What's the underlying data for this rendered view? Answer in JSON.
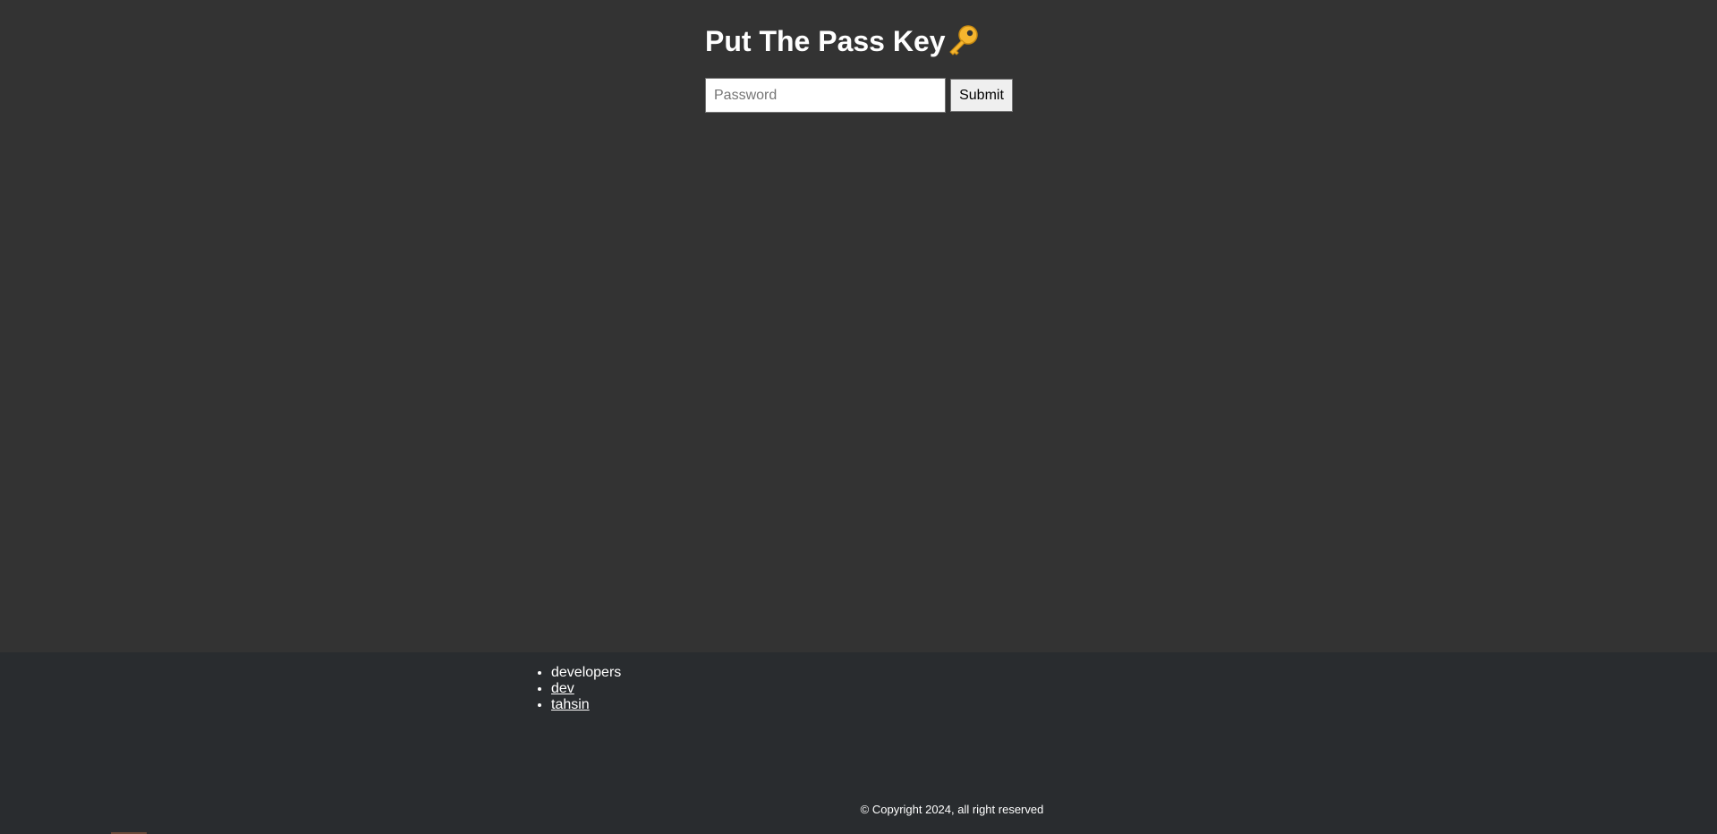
{
  "login": {
    "title": "Put The Pass Key",
    "title_icon": "key-icon",
    "password_placeholder": "Password",
    "password_value": "",
    "submit_label": "Submit"
  },
  "footer": {
    "list": {
      "heading": "developers",
      "links": [
        {
          "label": "dev"
        },
        {
          "label": "tahsin"
        }
      ]
    },
    "copyright": "© Copyright 2024, all right reserved"
  },
  "colors": {
    "main_background": "#333333",
    "footer_background": "#292c2f",
    "text": "#ffffff",
    "key_icon": "#f4b400"
  }
}
